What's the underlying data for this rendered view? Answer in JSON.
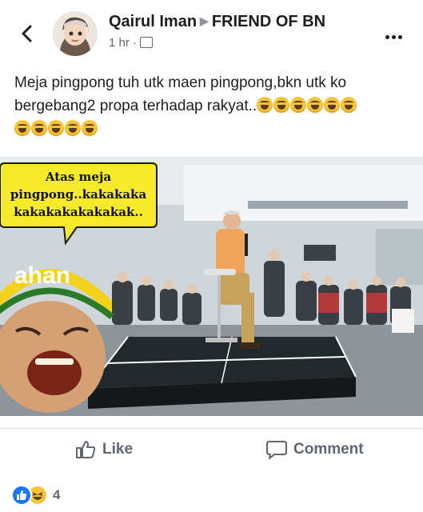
{
  "post": {
    "author": "Qairul Iman",
    "group": "FRIEND OF BN",
    "time": "1 hr",
    "text": "Meja pingpong tuh utk maen pingpong,bkn utk ko bergebang2 propa terhadap rakyat..",
    "emoji_line1_count": 6,
    "emoji_line2_count": 5
  },
  "image": {
    "bubble_text_1": "Atas meja",
    "bubble_text_2": "pingpong..kakakaka",
    "bubble_text_3": "kakakakakakakak..",
    "headband_text": "ahan"
  },
  "actions": {
    "like_label": "Like",
    "comment_label": "Comment"
  },
  "reactions": {
    "count": "4"
  },
  "colors": {
    "accent": "#1877f2",
    "bubble": "#f6ea2c",
    "table": "#1f2426"
  },
  "icons": {
    "back": "chevron-left-icon",
    "more": "more-dots-icon",
    "like": "thumbs-up-icon",
    "comment": "comment-bubble-icon"
  }
}
